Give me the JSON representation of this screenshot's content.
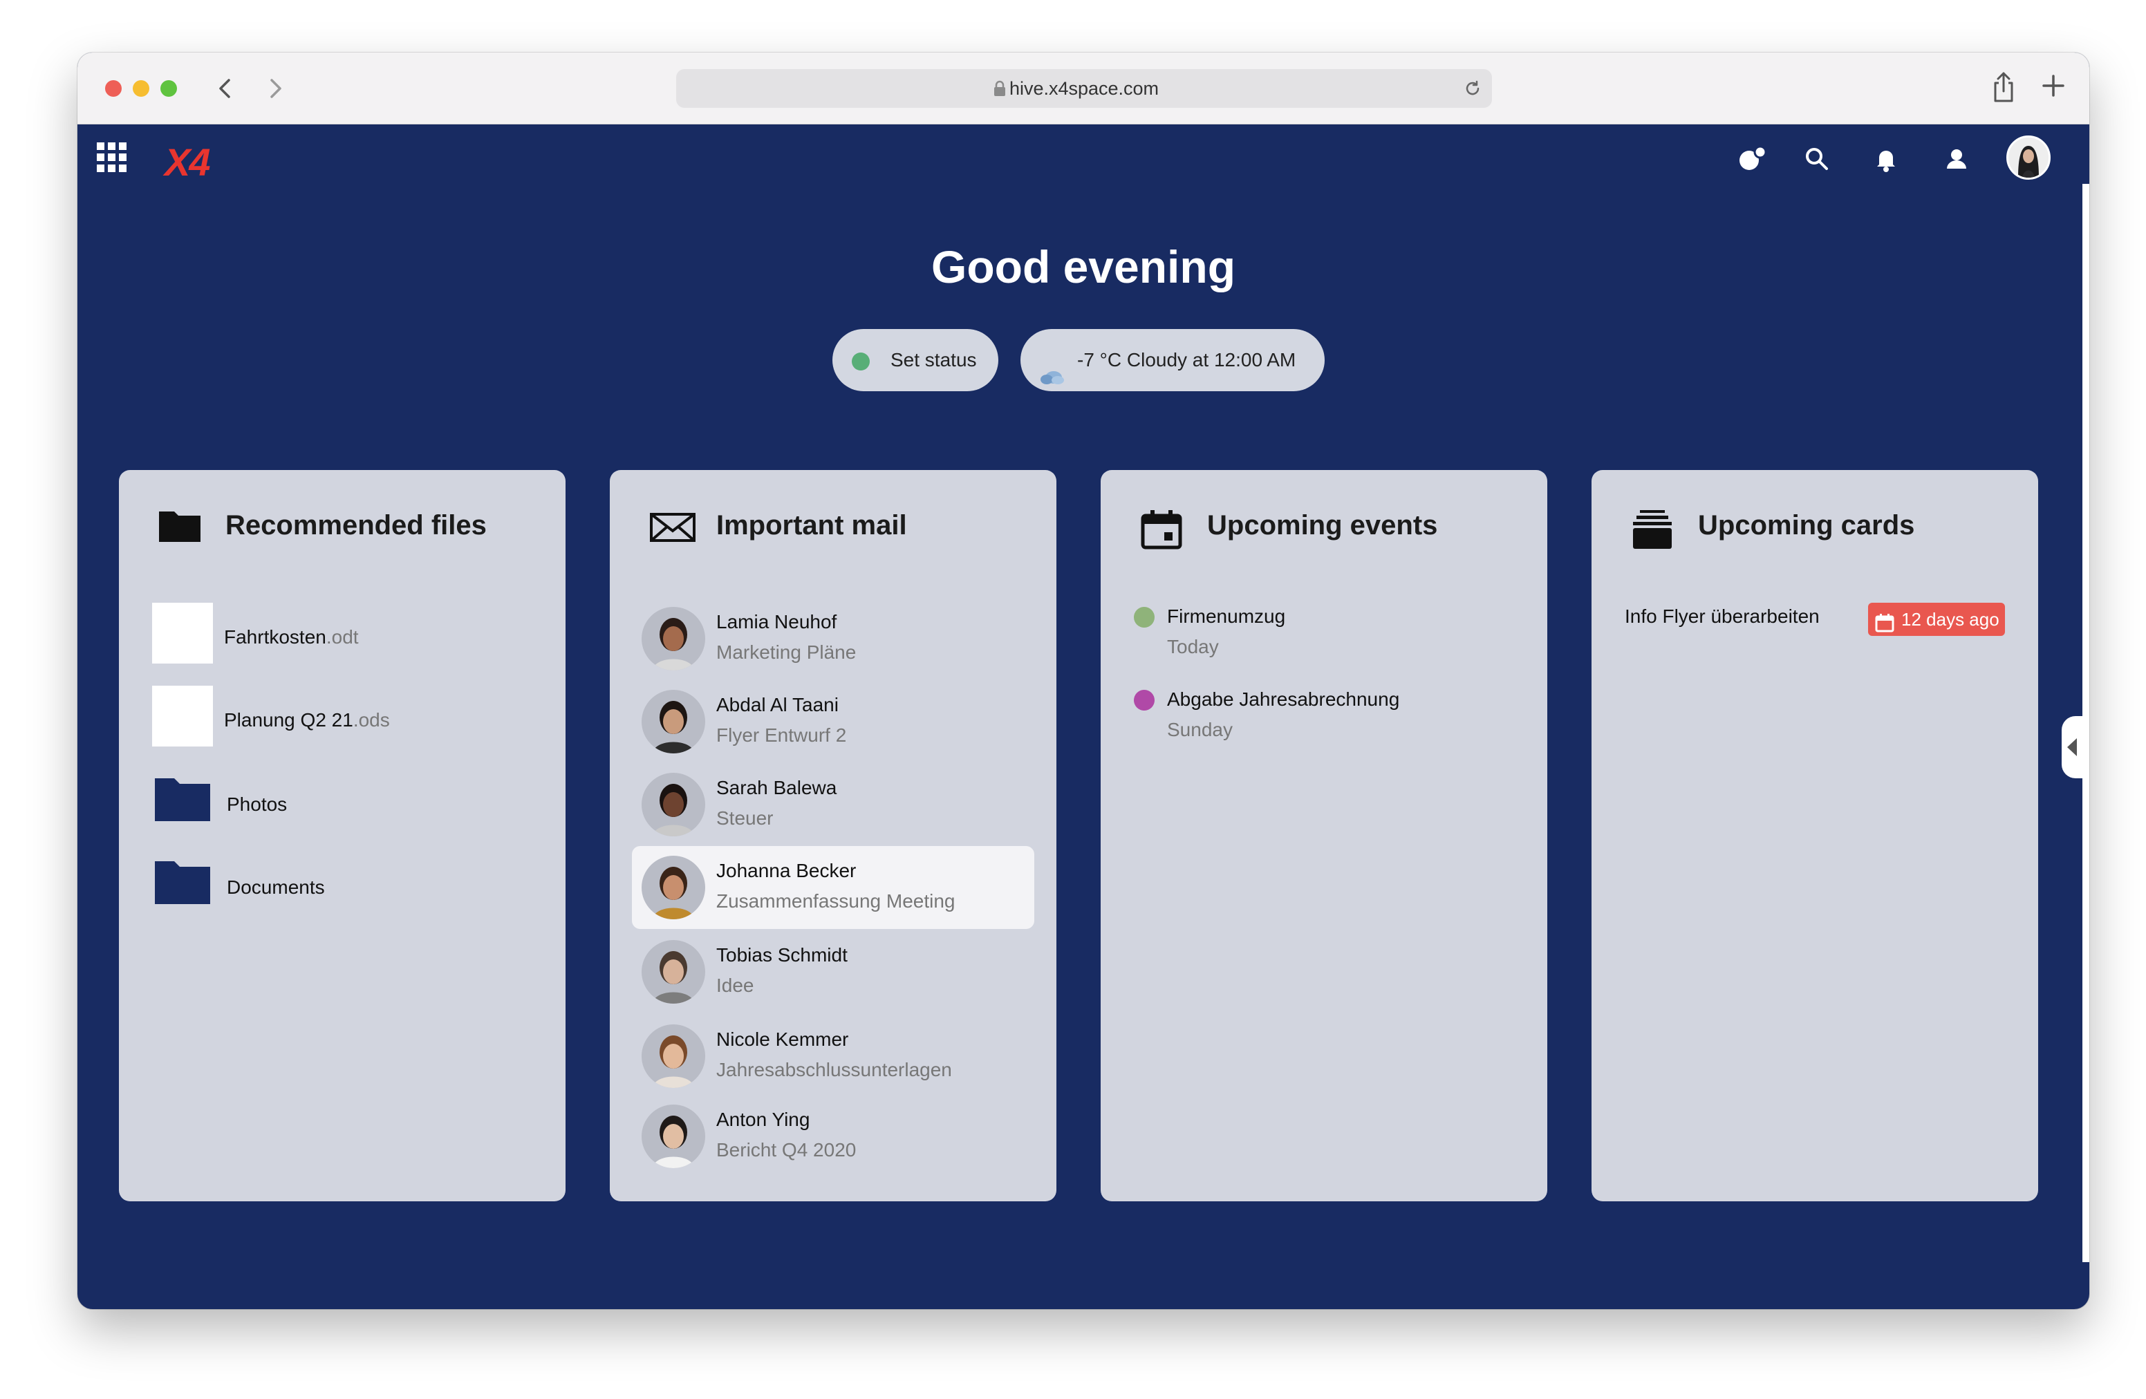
{
  "browser": {
    "url": "hive.x4space.com"
  },
  "app": {
    "logo_text": "X4"
  },
  "greeting": {
    "title": "Good evening",
    "status_label": "Set status",
    "weather_label": "-7 °C Cloudy at 12:00 AM"
  },
  "files": {
    "title": "Recommended files",
    "items": [
      {
        "name": "Fahrtkosten",
        "ext": ".odt"
      },
      {
        "name": "Planung Q2 21",
        "ext": ".ods"
      },
      {
        "name": "Photos",
        "ext": ""
      },
      {
        "name": "Documents",
        "ext": ""
      }
    ]
  },
  "mail": {
    "title": "Important mail",
    "items": [
      {
        "sender": "Lamia Neuhof",
        "subject": "Marketing Pläne",
        "skin": "#a46b4d",
        "hair": "#2a1c17",
        "shirt": "#d9d9d9"
      },
      {
        "sender": "Abdal Al Taani",
        "subject": "Flyer Entwurf 2",
        "skin": "#c99b7c",
        "hair": "#1e1613",
        "shirt": "#2d2d2d"
      },
      {
        "sender": "Sarah Balewa",
        "subject": "Steuer",
        "skin": "#6e4330",
        "hair": "#1a1210",
        "shirt": "#c9c9c9"
      },
      {
        "sender": "Johanna Becker",
        "subject": "Zusammenfassung Meeting",
        "skin": "#c88f6e",
        "hair": "#3a2418",
        "shirt": "#bf8a2e"
      },
      {
        "sender": "Tobias Schmidt",
        "subject": "Idee",
        "skin": "#d7b29a",
        "hair": "#4a3a30",
        "shirt": "#7d7d7d"
      },
      {
        "sender": "Nicole Kemmer",
        "subject": "Jahresabschlussunterlagen",
        "skin": "#e3b99a",
        "hair": "#7a4a2a",
        "shirt": "#e8e0d8"
      },
      {
        "sender": "Anton Ying",
        "subject": "Bericht Q4 2020",
        "skin": "#e1bea3",
        "hair": "#1f1a18",
        "shirt": "#f2f2f2"
      }
    ]
  },
  "events": {
    "title": "Upcoming events",
    "items": [
      {
        "name": "Firmenumzug",
        "when": "Today",
        "color": "#8fb37a"
      },
      {
        "name": "Abgabe Jahresabrechnung",
        "when": "Sunday",
        "color": "#b049a7"
      }
    ]
  },
  "cards": {
    "title": "Upcoming cards",
    "item_title": "Info Flyer überarbeiten",
    "item_due": "12 days ago"
  },
  "colors": {
    "background": "#182b62",
    "card": "#d2d5df",
    "accent_red": "#e8352f",
    "status_green": "#58ae77",
    "badge_red": "#e9574f"
  }
}
